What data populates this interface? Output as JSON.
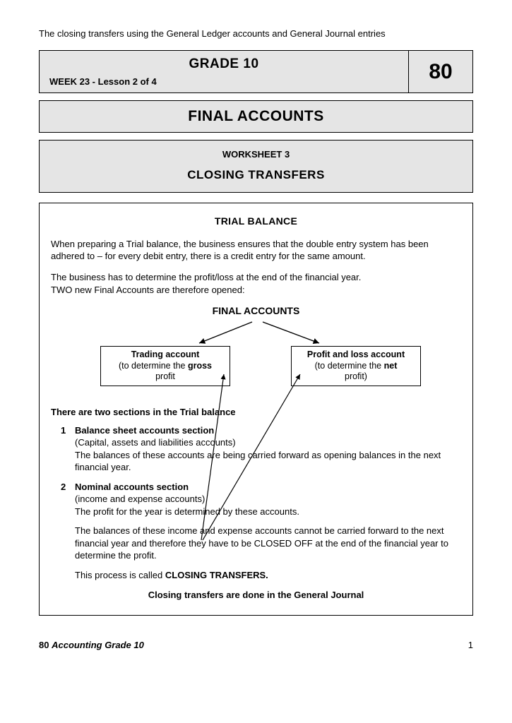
{
  "topLine": "The closing transfers using the General Ledger accounts and General Journal entries",
  "header": {
    "grade": "GRADE 10",
    "week": "WEEK 23  -  Lesson 2 of 4",
    "number": "80"
  },
  "mainTitle": "FINAL ACCOUNTS",
  "worksheet": {
    "label": "WORKSHEET 3",
    "title": "CLOSING TRANSFERS"
  },
  "content": {
    "tbHeading": "TRIAL BALANCE",
    "p1": "When preparing a Trial balance, the business ensures that the double entry system has been adhered to – for every debit entry, there is a credit entry for the same amount.",
    "p2a": "The business has to determine the profit/loss at the end of the financial year.",
    "p2b": "TWO new Final Accounts are therefore opened:",
    "faHeading": "FINAL ACCOUNTS",
    "box1": {
      "title": "Trading account",
      "line1a": "(to determine the ",
      "line1b": "gross",
      "line2": "profit"
    },
    "box2": {
      "title": "Profit and loss account",
      "line1a": "(to determine the ",
      "line1b": "net",
      "line2": "profit)"
    },
    "sectionsHeading": "There are two sections in the Trial balance",
    "item1": {
      "num": "1",
      "title": "Balance sheet accounts section",
      "sub1": "(Capital, assets and liabilities accounts)",
      "sub2": "The balances of these accounts are being carried forward as opening balances in the next financial year."
    },
    "item2": {
      "num": "2",
      "title": " Nominal accounts section",
      "sub1": "(income and expense accounts)",
      "sub2": " The profit for the year is determined by these accounts."
    },
    "p3": "The balances of these income and expense accounts cannot be carried forward to the next financial year and therefore they have to be CLOSED OFF at the end of the financial year to determine the profit.",
    "p4a": "This process is called ",
    "p4b": "CLOSING TRANSFERS.",
    "closingLine": "Closing transfers are done in the General Journal"
  },
  "footer": {
    "num": "80",
    "book": "Accounting Grade 10",
    "page": "1"
  }
}
